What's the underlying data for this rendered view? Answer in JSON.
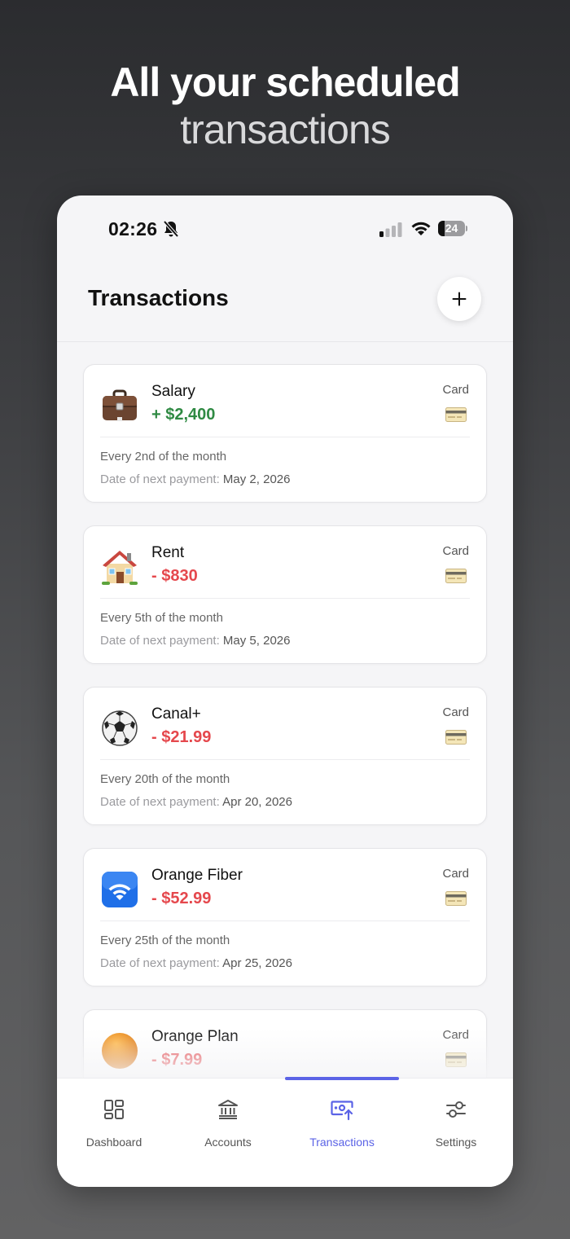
{
  "headline": {
    "line1": "All your scheduled",
    "line2": "transactions"
  },
  "status_bar": {
    "time": "02:26",
    "battery": "24",
    "icons": [
      "bell-slash-icon",
      "signal-icon",
      "wifi-icon",
      "battery-icon"
    ]
  },
  "header": {
    "title": "Transactions",
    "add_button_icon": "plus-icon"
  },
  "transactions": [
    {
      "name": "Salary",
      "amount": "+ $2,400",
      "direction": "income",
      "icon": "briefcase-icon",
      "method": "Card",
      "frequency": "Every 2nd of the month",
      "next_label": "Date of next payment:",
      "next_date": "May 2, 2026"
    },
    {
      "name": "Rent",
      "amount": "- $830",
      "direction": "expense",
      "icon": "house-icon",
      "method": "Card",
      "frequency": "Every 5th of the month",
      "next_label": "Date of next payment:",
      "next_date": "May 5, 2026"
    },
    {
      "name": "Canal+",
      "amount": "- $21.99",
      "direction": "expense",
      "icon": "soccer-ball-icon",
      "method": "Card",
      "frequency": "Every 20th of the month",
      "next_label": "Date of next payment:",
      "next_date": "Apr 20, 2026"
    },
    {
      "name": "Orange Fiber",
      "amount": "- $52.99",
      "direction": "expense",
      "icon": "wifi-app-icon",
      "method": "Card",
      "frequency": "Every 25th of the month",
      "next_label": "Date of next payment:",
      "next_date": "Apr 25, 2026"
    },
    {
      "name": "Orange Plan",
      "amount": "- $7.99",
      "direction": "expense",
      "icon": "orange-circle-icon",
      "method": "Card",
      "frequency": "",
      "next_label": "",
      "next_date": ""
    }
  ],
  "tab_bar": {
    "tabs": [
      {
        "label": "Dashboard",
        "icon": "dashboard-grid-icon",
        "active": false
      },
      {
        "label": "Accounts",
        "icon": "bank-icon",
        "active": false
      },
      {
        "label": "Transactions",
        "icon": "money-transfer-icon",
        "active": true
      },
      {
        "label": "Settings",
        "icon": "sliders-icon",
        "active": false
      }
    ]
  },
  "colors": {
    "accent": "#5b63e6",
    "income": "#2f8a43",
    "expense": "#e5484d"
  }
}
